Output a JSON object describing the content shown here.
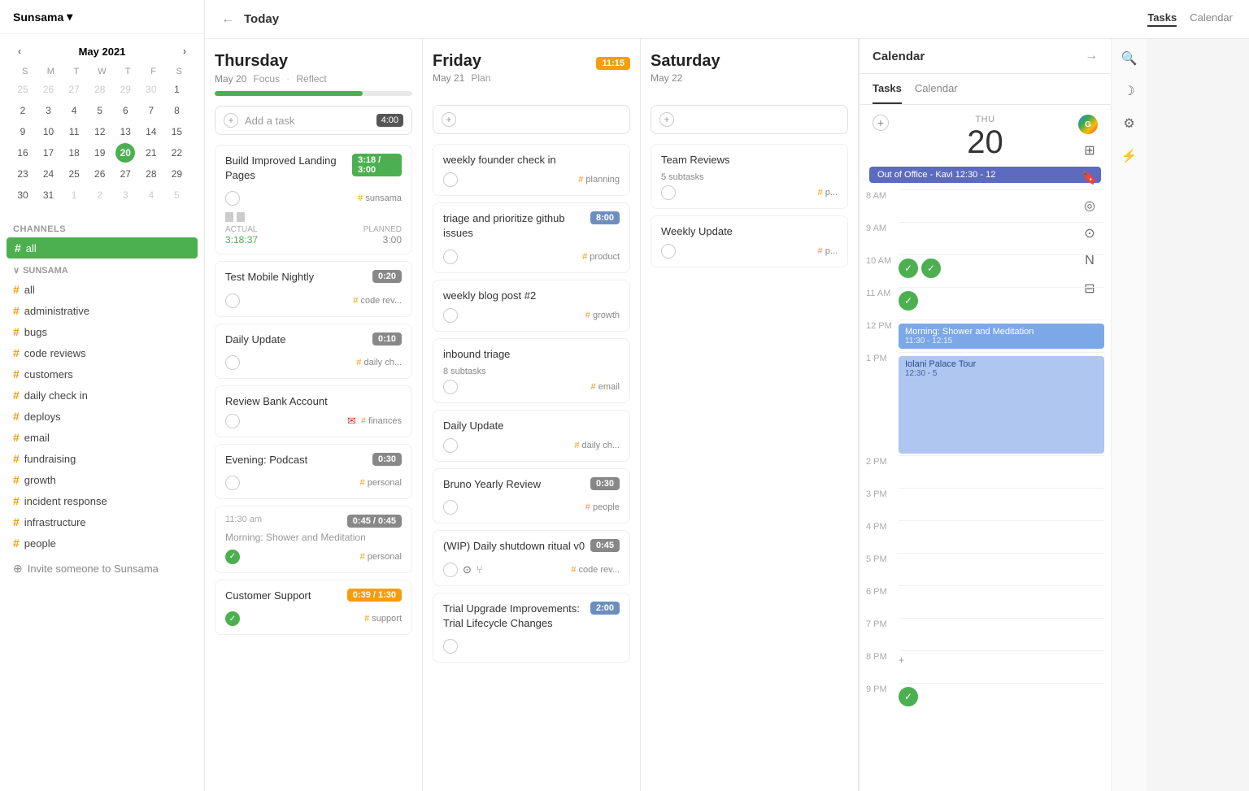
{
  "app": {
    "title": "Sunsama",
    "title_caret": "▾"
  },
  "sidebar": {
    "calendar": {
      "month_year": "May 2021",
      "day_headers": [
        "S",
        "M",
        "T",
        "W",
        "T",
        "F",
        "S"
      ],
      "weeks": [
        [
          {
            "d": "25",
            "other": true
          },
          {
            "d": "26",
            "other": true
          },
          {
            "d": "27",
            "other": true
          },
          {
            "d": "28",
            "other": true
          },
          {
            "d": "29",
            "other": true
          },
          {
            "d": "30",
            "other": true
          },
          {
            "d": "1",
            "other": false
          }
        ],
        [
          {
            "d": "2"
          },
          {
            "d": "3"
          },
          {
            "d": "4"
          },
          {
            "d": "5"
          },
          {
            "d": "6"
          },
          {
            "d": "7"
          },
          {
            "d": "8"
          }
        ],
        [
          {
            "d": "9"
          },
          {
            "d": "10"
          },
          {
            "d": "11"
          },
          {
            "d": "12"
          },
          {
            "d": "13"
          },
          {
            "d": "14"
          },
          {
            "d": "15"
          }
        ],
        [
          {
            "d": "16"
          },
          {
            "d": "17"
          },
          {
            "d": "18"
          },
          {
            "d": "19"
          },
          {
            "d": "20",
            "today": true
          },
          {
            "d": "21"
          },
          {
            "d": "22"
          }
        ],
        [
          {
            "d": "23"
          },
          {
            "d": "24"
          },
          {
            "d": "25"
          },
          {
            "d": "26"
          },
          {
            "d": "27"
          },
          {
            "d": "28"
          },
          {
            "d": "29"
          }
        ],
        [
          {
            "d": "30"
          },
          {
            "d": "31"
          },
          {
            "d": "1",
            "other": true
          },
          {
            "d": "2",
            "other": true
          },
          {
            "d": "3",
            "other": true
          },
          {
            "d": "4",
            "other": true
          },
          {
            "d": "5",
            "other": true
          }
        ]
      ]
    },
    "channels_label": "CHANNELS",
    "all_channel": "# all",
    "sunsama_group": "SUNSAMA",
    "channels": [
      {
        "name": "all",
        "hash": true
      },
      {
        "name": "administrative",
        "hash": true
      },
      {
        "name": "bugs",
        "hash": true
      },
      {
        "name": "code reviews",
        "hash": true
      },
      {
        "name": "customers",
        "hash": true
      },
      {
        "name": "daily check in",
        "hash": true
      },
      {
        "name": "deploys",
        "hash": true
      },
      {
        "name": "email",
        "hash": true
      },
      {
        "name": "fundraising",
        "hash": true
      },
      {
        "name": "growth",
        "hash": true
      },
      {
        "name": "incident response",
        "hash": true
      },
      {
        "name": "infrastructure",
        "hash": true
      },
      {
        "name": "people",
        "hash": true
      }
    ],
    "invite_label": "Invite someone to Sunsama"
  },
  "topbar": {
    "back_icon": "←",
    "title": "Today",
    "tasks_tab": "Tasks",
    "calendar_tab": "Calendar"
  },
  "thursday": {
    "day_name": "Thursday",
    "date": "May 20",
    "focus_label": "Focus",
    "reflect_label": "Reflect",
    "progress": 75,
    "add_task_placeholder": "Add a task",
    "add_task_time": "4:00",
    "tasks": [
      {
        "title": "Build Improved Landing Pages",
        "time_badge": "3:18 / 3:00",
        "time_color": "green",
        "tag": "sunsama",
        "actual_label": "ACTUAL",
        "planned_label": "PLANNED",
        "actual_time": "3:18:37",
        "planned_time": "3:00",
        "checked": false
      },
      {
        "title": "Test Mobile Nightly",
        "time_badge": "0:20",
        "time_color": "gray",
        "tag": "code rev...",
        "checked": false
      },
      {
        "title": "Daily Update",
        "time_badge": "0:10",
        "time_color": "gray",
        "tag": "daily ch...",
        "checked": false
      },
      {
        "title": "Review Bank Account",
        "tag": "finances",
        "has_gmail": true,
        "checked": false
      },
      {
        "title": "Evening: Podcast",
        "time_badge": "0:30",
        "time_color": "gray",
        "tag": "personal",
        "checked": false
      },
      {
        "timestamp": "11:30 am",
        "time_badge": "0:45 / 0:45",
        "time_color": "gray",
        "title_small": "Morning: Shower and Meditation",
        "tag": "personal",
        "checked": true
      },
      {
        "title": "Customer Support",
        "time_badge": "0:39 / 1:30",
        "time_color": "orange",
        "tag": "support",
        "checked": true
      }
    ]
  },
  "friday": {
    "day_name": "Friday",
    "date": "May 21",
    "plan_label": "Plan",
    "time_badge": "11:15",
    "time_color": "orange",
    "tasks": [
      {
        "title": "weekly founder check in",
        "tag": "planning",
        "checked": false
      },
      {
        "title": "triage and prioritize github issues",
        "time_badge": "8:00",
        "time_color": "blue",
        "tag": "product",
        "checked": false
      },
      {
        "title": "weekly blog post #2",
        "tag": "growth",
        "checked": false
      },
      {
        "title": "inbound triage",
        "subtasks": "8 subtasks",
        "tag": "email",
        "checked": false
      },
      {
        "title": "Daily Update",
        "tag": "daily ch...",
        "checked": false
      },
      {
        "title": "Bruno Yearly Review",
        "time_badge": "0:30",
        "time_color": "gray",
        "tag": "people",
        "checked": false
      },
      {
        "title": "(WIP) Daily shutdown ritual v0",
        "time_badge": "0:45",
        "time_color": "gray",
        "tag": "code rev...",
        "has_github": true,
        "has_branch": true,
        "checked": false
      },
      {
        "title": "Trial Upgrade Improvements: Trial Lifecycle Changes",
        "time_badge": "2:00",
        "time_color": "blue",
        "checked": false
      }
    ]
  },
  "saturday": {
    "day_name": "Saturday",
    "date": "May 22",
    "tasks": [
      {
        "title": "Team Reviews",
        "subtasks": "5 subtasks",
        "tag": "p...",
        "checked": false
      },
      {
        "title": "Weekly Update",
        "tag": "p...",
        "checked": false
      }
    ]
  },
  "calendar_panel": {
    "title": "Calendar",
    "tabs": [
      "Tasks",
      "Calendar"
    ],
    "active_tab": "Tasks",
    "day_label": "THU",
    "day_num": "20",
    "ooo_event": "Out of Office - Kavi  12:30 - 12",
    "times": [
      "8 AM",
      "9 AM",
      "10 AM",
      "11 AM",
      "12 PM",
      "1 PM",
      "2 PM",
      "3 PM",
      "4 PM",
      "5 PM",
      "6 PM",
      "7 PM",
      "8 PM",
      "9 PM"
    ],
    "events": [
      {
        "time": "12 PM",
        "label": "Morning: Shower and Meditation",
        "sublabel": "11:30 - 12:15",
        "color": "blue-main"
      },
      {
        "time": "1 PM",
        "label": "Iolani Palace Tour",
        "sublabel": "12:30 - 5",
        "color": "blue-light"
      }
    ],
    "green_checks_at": [
      "10 AM",
      "11 AM"
    ],
    "green_check_at_9pm": true
  }
}
